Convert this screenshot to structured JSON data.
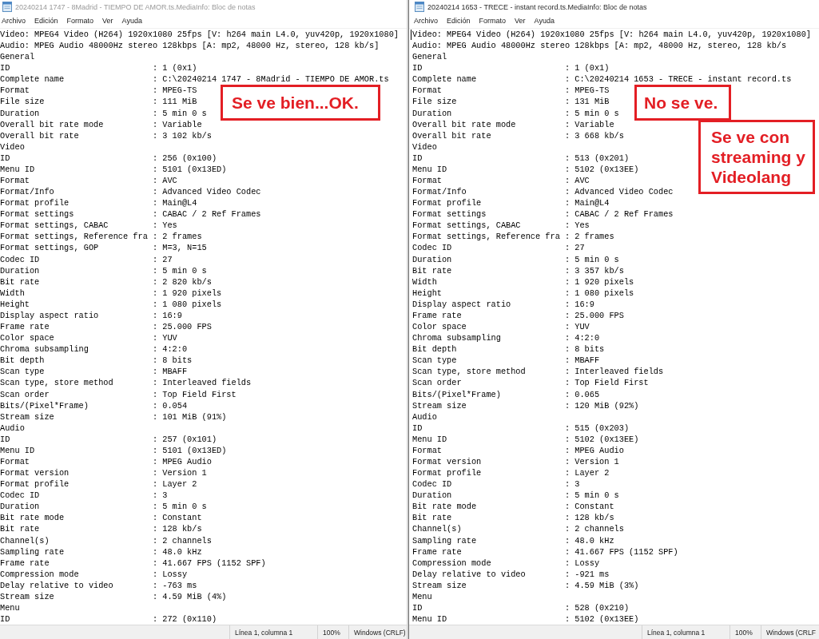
{
  "windows": [
    {
      "title": "20240214 1747 - 8Madrid - TIEMPO DE AMOR.ts.MediaInfo: Bloc de notas",
      "focused": false,
      "menu": [
        "Archivo",
        "Edición",
        "Formato",
        "Ver",
        "Ayuda"
      ],
      "lines": [
        {
          "kind": "text",
          "text": "Video: MPEG4 Video (H264) 1920x1080 25fps [V: h264 main L4.0, yuv420p, 1920x1080]"
        },
        {
          "kind": "text",
          "text": "Audio: MPEG Audio 48000Hz stereo 128kbps [A: mp2, 48000 Hz, stereo, 128 kb/s]"
        },
        {
          "kind": "text",
          "text": "General"
        },
        {
          "kind": "field",
          "label": "ID",
          "value": ": 1 (0x1)"
        },
        {
          "kind": "field",
          "label": "Complete name",
          "value": ": C:\\20240214 1747 - 8Madrid - TIEMPO DE AMOR.ts"
        },
        {
          "kind": "field",
          "label": "Format",
          "value": ": MPEG-TS"
        },
        {
          "kind": "field",
          "label": "File size",
          "value": ": 111 MiB"
        },
        {
          "kind": "field",
          "label": "Duration",
          "value": ": 5 min 0 s"
        },
        {
          "kind": "field",
          "label": "Overall bit rate mode",
          "value": ": Variable"
        },
        {
          "kind": "field",
          "label": "Overall bit rate",
          "value": ": 3 102 kb/s"
        },
        {
          "kind": "text",
          "text": "Video"
        },
        {
          "kind": "field",
          "label": "ID",
          "value": ": 256 (0x100)"
        },
        {
          "kind": "field",
          "label": "Menu ID",
          "value": ": 5101 (0x13ED)"
        },
        {
          "kind": "field",
          "label": "Format",
          "value": ": AVC"
        },
        {
          "kind": "field",
          "label": "Format/Info",
          "value": ": Advanced Video Codec"
        },
        {
          "kind": "field",
          "label": "Format profile",
          "value": ": Main@L4"
        },
        {
          "kind": "field",
          "label": "Format settings",
          "value": ": CABAC / 2 Ref Frames"
        },
        {
          "kind": "field",
          "label": "Format settings, CABAC",
          "value": ": Yes"
        },
        {
          "kind": "field",
          "label": "Format settings, Reference fra",
          "value": ": 2 frames"
        },
        {
          "kind": "field",
          "label": "Format settings, GOP",
          "value": ": M=3, N=15"
        },
        {
          "kind": "field",
          "label": "Codec ID",
          "value": ": 27"
        },
        {
          "kind": "field",
          "label": "Duration",
          "value": ": 5 min 0 s"
        },
        {
          "kind": "field",
          "label": "Bit rate",
          "value": ": 2 820 kb/s"
        },
        {
          "kind": "field",
          "label": "Width",
          "value": ": 1 920 pixels"
        },
        {
          "kind": "field",
          "label": "Height",
          "value": ": 1 080 pixels"
        },
        {
          "kind": "field",
          "label": "Display aspect ratio",
          "value": ": 16:9"
        },
        {
          "kind": "field",
          "label": "Frame rate",
          "value": ": 25.000 FPS"
        },
        {
          "kind": "field",
          "label": "Color space",
          "value": ": YUV"
        },
        {
          "kind": "field",
          "label": "Chroma subsampling",
          "value": ": 4:2:0"
        },
        {
          "kind": "field",
          "label": "Bit depth",
          "value": ": 8 bits"
        },
        {
          "kind": "field",
          "label": "Scan type",
          "value": ": MBAFF"
        },
        {
          "kind": "field",
          "label": "Scan type, store method",
          "value": ": Interleaved fields"
        },
        {
          "kind": "field",
          "label": "Scan order",
          "value": ": Top Field First"
        },
        {
          "kind": "field",
          "label": "Bits/(Pixel*Frame)",
          "value": ": 0.054"
        },
        {
          "kind": "field",
          "label": "Stream size",
          "value": ": 101 MiB (91%)"
        },
        {
          "kind": "text",
          "text": "Audio"
        },
        {
          "kind": "field",
          "label": "ID",
          "value": ": 257 (0x101)"
        },
        {
          "kind": "field",
          "label": "Menu ID",
          "value": ": 5101 (0x13ED)"
        },
        {
          "kind": "field",
          "label": "Format",
          "value": ": MPEG Audio"
        },
        {
          "kind": "field",
          "label": "Format version",
          "value": ": Version 1"
        },
        {
          "kind": "field",
          "label": "Format profile",
          "value": ": Layer 2"
        },
        {
          "kind": "field",
          "label": "Codec ID",
          "value": ": 3"
        },
        {
          "kind": "field",
          "label": "Duration",
          "value": ": 5 min 0 s"
        },
        {
          "kind": "field",
          "label": "Bit rate mode",
          "value": ": Constant"
        },
        {
          "kind": "field",
          "label": "Bit rate",
          "value": ": 128 kb/s"
        },
        {
          "kind": "field",
          "label": "Channel(s)",
          "value": ": 2 channels"
        },
        {
          "kind": "field",
          "label": "Sampling rate",
          "value": ": 48.0 kHz"
        },
        {
          "kind": "field",
          "label": "Frame rate",
          "value": ": 41.667 FPS (1152 SPF)"
        },
        {
          "kind": "field",
          "label": "Compression mode",
          "value": ": Lossy"
        },
        {
          "kind": "field",
          "label": "Delay relative to video",
          "value": ": -763 ms"
        },
        {
          "kind": "field",
          "label": "Stream size",
          "value": ": 4.59 MiB (4%)"
        },
        {
          "kind": "text",
          "text": "Menu"
        },
        {
          "kind": "field",
          "label": "ID",
          "value": ": 272 (0x110)"
        }
      ],
      "status_bar": [
        "Línea 1, columna 1",
        "100%",
        "Windows (CRLF)"
      ],
      "annotations": [
        "Se ve bien...OK."
      ]
    },
    {
      "title": "20240214 1653 - TRECE - instant record.ts.MediaInfo: Bloc de notas",
      "focused": true,
      "menu": [
        "Archivo",
        "Edición",
        "Formato",
        "Ver",
        "Ayuda"
      ],
      "lines": [
        {
          "kind": "text",
          "text": "Video: MPEG4 Video (H264) 1920x1080 25fps [V: h264 main L4.0, yuv420p, 1920x1080]"
        },
        {
          "kind": "text",
          "text": "Audio: MPEG Audio 48000Hz stereo 128kbps [A: mp2, 48000 Hz, stereo, 128 kb/s"
        },
        {
          "kind": "text",
          "text": "General"
        },
        {
          "kind": "field",
          "label": "ID",
          "value": ": 1 (0x1)"
        },
        {
          "kind": "field",
          "label": "Complete name",
          "value": ": C:\\20240214 1653 - TRECE - instant record.ts"
        },
        {
          "kind": "field",
          "label": "Format",
          "value": ": MPEG-TS"
        },
        {
          "kind": "field",
          "label": "File size",
          "value": ": 131 MiB"
        },
        {
          "kind": "field",
          "label": "Duration",
          "value": ": 5 min 0 s"
        },
        {
          "kind": "field",
          "label": "Overall bit rate mode",
          "value": ": Variable"
        },
        {
          "kind": "field",
          "label": "Overall bit rate",
          "value": ": 3 668 kb/s"
        },
        {
          "kind": "text",
          "text": "Video"
        },
        {
          "kind": "field",
          "label": "ID",
          "value": ": 513 (0x201)"
        },
        {
          "kind": "field",
          "label": "Menu ID",
          "value": ": 5102 (0x13EE)"
        },
        {
          "kind": "field",
          "label": "Format",
          "value": ": AVC"
        },
        {
          "kind": "field",
          "label": "Format/Info",
          "value": ": Advanced Video Codec"
        },
        {
          "kind": "field",
          "label": "Format profile",
          "value": ": Main@L4"
        },
        {
          "kind": "field",
          "label": "Format settings",
          "value": ": CABAC / 2 Ref Frames"
        },
        {
          "kind": "field",
          "label": "Format settings, CABAC",
          "value": ": Yes"
        },
        {
          "kind": "field",
          "label": "Format settings, Reference fra",
          "value": ": 2 frames"
        },
        {
          "kind": "field",
          "label": "Codec ID",
          "value": ": 27"
        },
        {
          "kind": "field",
          "label": "Duration",
          "value": ": 5 min 0 s"
        },
        {
          "kind": "field",
          "label": "Bit rate",
          "value": ": 3 357 kb/s"
        },
        {
          "kind": "field",
          "label": "Width",
          "value": ": 1 920 pixels"
        },
        {
          "kind": "field",
          "label": "Height",
          "value": ": 1 080 pixels"
        },
        {
          "kind": "field",
          "label": "Display aspect ratio",
          "value": ": 16:9"
        },
        {
          "kind": "field",
          "label": "Frame rate",
          "value": ": 25.000 FPS"
        },
        {
          "kind": "field",
          "label": "Color space",
          "value": ": YUV"
        },
        {
          "kind": "field",
          "label": "Chroma subsampling",
          "value": ": 4:2:0"
        },
        {
          "kind": "field",
          "label": "Bit depth",
          "value": ": 8 bits"
        },
        {
          "kind": "field",
          "label": "Scan type",
          "value": ": MBAFF"
        },
        {
          "kind": "field",
          "label": "Scan type, store method",
          "value": ": Interleaved fields"
        },
        {
          "kind": "field",
          "label": "Scan order",
          "value": ": Top Field First"
        },
        {
          "kind": "field",
          "label": "Bits/(Pixel*Frame)",
          "value": ": 0.065"
        },
        {
          "kind": "field",
          "label": "Stream size",
          "value": ": 120 MiB (92%)"
        },
        {
          "kind": "text",
          "text": "Audio"
        },
        {
          "kind": "field",
          "label": "ID",
          "value": ": 515 (0x203)"
        },
        {
          "kind": "field",
          "label": "Menu ID",
          "value": ": 5102 (0x13EE)"
        },
        {
          "kind": "field",
          "label": "Format",
          "value": ": MPEG Audio"
        },
        {
          "kind": "field",
          "label": "Format version",
          "value": ": Version 1"
        },
        {
          "kind": "field",
          "label": "Format profile",
          "value": ": Layer 2"
        },
        {
          "kind": "field",
          "label": "Codec ID",
          "value": ": 3"
        },
        {
          "kind": "field",
          "label": "Duration",
          "value": ": 5 min 0 s"
        },
        {
          "kind": "field",
          "label": "Bit rate mode",
          "value": ": Constant"
        },
        {
          "kind": "field",
          "label": "Bit rate",
          "value": ": 128 kb/s"
        },
        {
          "kind": "field",
          "label": "Channel(s)",
          "value": ": 2 channels"
        },
        {
          "kind": "field",
          "label": "Sampling rate",
          "value": ": 48.0 kHz"
        },
        {
          "kind": "field",
          "label": "Frame rate",
          "value": ": 41.667 FPS (1152 SPF)"
        },
        {
          "kind": "field",
          "label": "Compression mode",
          "value": ": Lossy"
        },
        {
          "kind": "field",
          "label": "Delay relative to video",
          "value": ": -921 ms"
        },
        {
          "kind": "field",
          "label": "Stream size",
          "value": ": 4.59 MiB (3%)"
        },
        {
          "kind": "text",
          "text": "Menu"
        },
        {
          "kind": "field",
          "label": "ID",
          "value": ": 528 (0x210)"
        },
        {
          "kind": "field",
          "label": "Menu ID",
          "value": ": 5102 (0x13EE)"
        }
      ],
      "status_bar": [
        "Línea 1, columna 1",
        "100%",
        "Windows (CRLF"
      ],
      "annotations": [
        "No se ve.",
        "Se ve con streaming y Videolang"
      ]
    }
  ]
}
